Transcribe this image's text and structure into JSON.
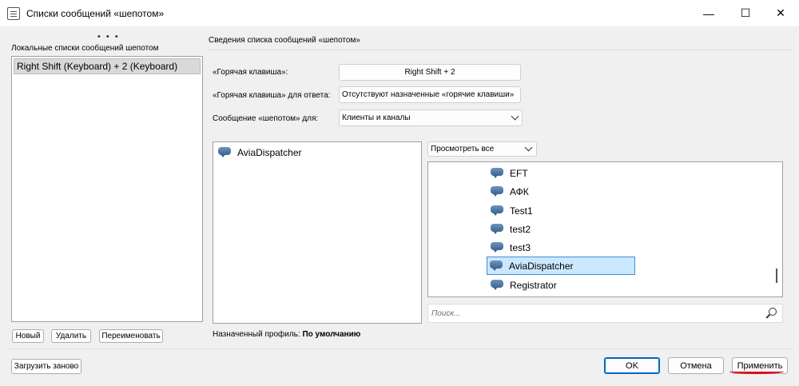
{
  "window": {
    "title": "Списки сообщений «шепотом»",
    "minimize": "—",
    "maximize": "☐",
    "close": "✕"
  },
  "left": {
    "dots": "• • •",
    "label": "Локальные списки сообщений шепотом",
    "items": [
      "Right Shift (Keyboard) + 2 (Keyboard)"
    ],
    "buttons": {
      "new": "Новый",
      "delete": "Удалить",
      "rename": "Переименовать",
      "reload": "Загрузить заново"
    }
  },
  "details": {
    "header": "Сведения списка сообщений «шепотом»",
    "hotkey_label": "«Горячая клавиша»:",
    "hotkey_value": "Right Shift + 2",
    "reply_label": "«Горячая клавиша» для ответа:",
    "reply_value": "Отсутствуют назначенные «горячие клавиши»",
    "for_label": "Сообщение «шепотом» для:",
    "for_value": "Клиенты и каналы"
  },
  "recipients": [
    "AviaDispatcher"
  ],
  "browser": {
    "view_select": "Просмотреть все",
    "items": [
      "EFT",
      "АФК",
      "Test1",
      "test2",
      "test3",
      "AviaDispatcher",
      "Registrator"
    ],
    "selected": "AviaDispatcher",
    "search_placeholder": "Поиск..."
  },
  "profile": {
    "label": "Назначенный профиль:",
    "value": "По умолчанию"
  },
  "footer": {
    "ok": "OK",
    "cancel": "Отмена",
    "apply": "Применить"
  },
  "colors": {
    "selection_bg": "#cce8ff",
    "selection_border": "#3d8ed8",
    "default_button_border": "#0067c0",
    "annotation_red": "#e0001b"
  }
}
